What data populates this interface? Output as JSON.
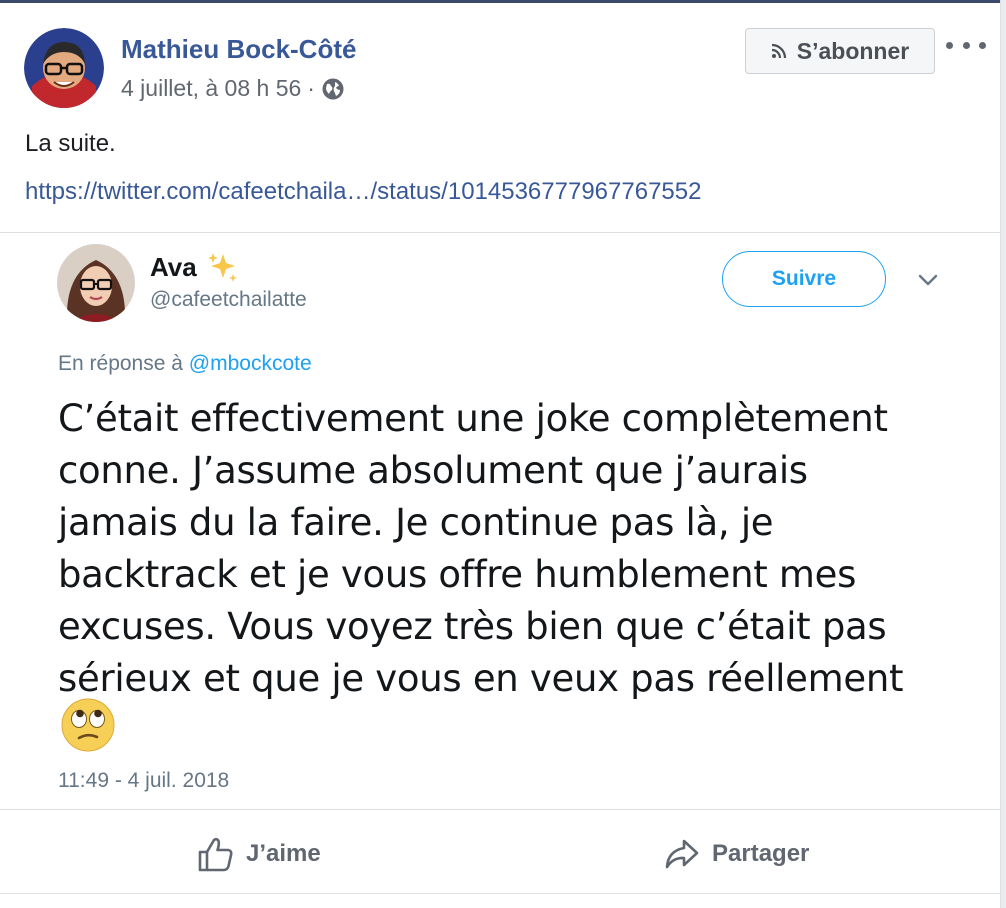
{
  "post": {
    "author": "Mathieu Bock-Côté",
    "timestamp": "4 juillet, à 08 h 56",
    "separator": "·",
    "audience_icon": "globe-icon",
    "follow_label": "S’abonner",
    "follow_icon": "rss-icon",
    "more_icon": "more-options-icon",
    "text": "La suite.",
    "link": "https://twitter.com/cafeetchaila…/status/1014536777967767552"
  },
  "tweet": {
    "name": "Ava",
    "name_emoji": "sparkles-icon",
    "handle": "@cafeetchailatte",
    "follow_label": "Suivre",
    "reply_prefix": "En réponse à",
    "reply_to": "@mbockcote",
    "lines": [
      "C’était effectivement une joke complètement",
      "conne. J’assume absolument que j’aurais",
      "jamais du la faire. Je continue pas là, je",
      "backtrack et je vous offre humblement mes",
      "excuses. Vous voyez très bien que c’était pas",
      "sérieux et que je vous en veux pas réellement"
    ],
    "emoji": "eye-roll-emoji",
    "time": "11:49 - 4 juil. 2018"
  },
  "actions": {
    "like_label": "J’aime",
    "share_label": "Partager"
  },
  "colors": {
    "fb_link": "#385898",
    "twitter_blue": "#1da1f2",
    "meta_gray": "#616770"
  }
}
